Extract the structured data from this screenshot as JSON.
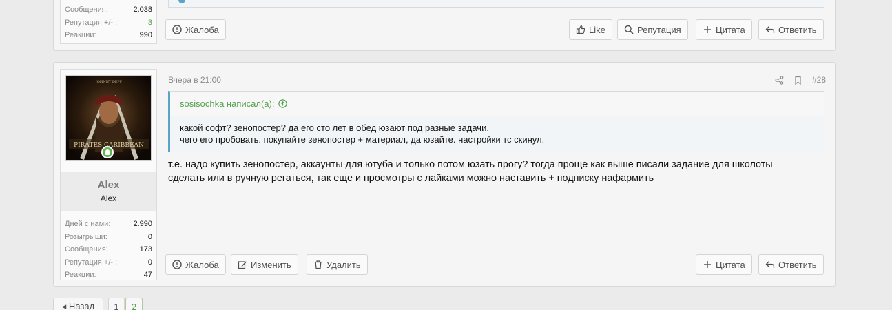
{
  "top_post": {
    "stats": [
      {
        "label": "Сообщения:",
        "value": "2.038"
      },
      {
        "label": "Репутация +/- :",
        "value": "3"
      },
      {
        "label": "Реакции:",
        "value": "990"
      }
    ],
    "buttons": {
      "report": "Жалоба",
      "like": "Like",
      "reputation": "Репутация",
      "quote": "Цитата",
      "reply": "Ответить"
    }
  },
  "post": {
    "date": "Вчера в 21:00",
    "number": "#28",
    "user": {
      "name": "Alex",
      "title": "Alex",
      "stats": [
        {
          "label": "Дней с нами:",
          "value": "2.990"
        },
        {
          "label": "Розыгрыши:",
          "value": "0"
        },
        {
          "label": "Сообщения:",
          "value": "173"
        },
        {
          "label": "Репутация +/- :",
          "value": "0"
        },
        {
          "label": "Реакции:",
          "value": "47"
        }
      ]
    },
    "quote": {
      "author": "sosisochka написал(а):",
      "lines": [
        "какой софт? зенопостер? да его сто лет в обед юзают под разные задачи.",
        "чего его пробовать. покупайте зенопостер + материал, да юзайте. настройки тс скинул."
      ]
    },
    "message_lines": [
      "т.е. надо купить зенопостер, аккаунты для ютуба и только потом юзать прогу? тогда проще как выше писали задание для школоты",
      "сделать или в ручную регаться, так еще и просмотры с лайками можно наставить + подписку нафармить"
    ],
    "buttons": {
      "report": "Жалоба",
      "edit": "Изменить",
      "delete": "Удалить",
      "quote": "Цитата",
      "reply": "Ответить"
    }
  },
  "pagination": {
    "prev": "◂ Назад",
    "pages": [
      "1",
      "2"
    ],
    "current": "2"
  },
  "colors": {
    "accent_green": "#55a04d",
    "quote_border": "#5aa5c7",
    "online": "#63b356"
  }
}
